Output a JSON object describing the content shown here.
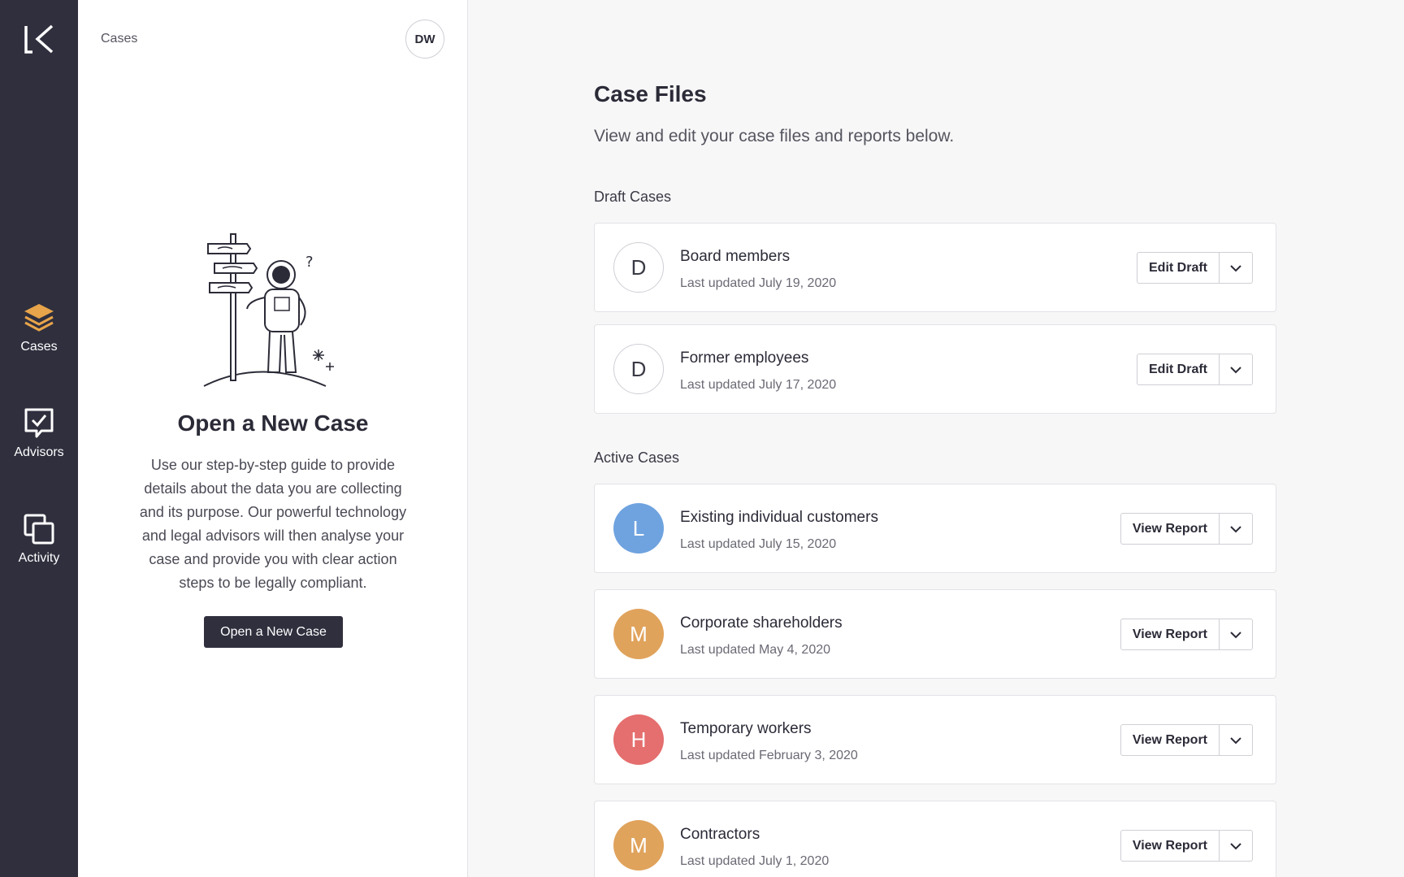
{
  "sidebar": {
    "items": [
      {
        "label": "Cases",
        "icon": "layers-icon",
        "active": true
      },
      {
        "label": "Advisors",
        "icon": "chat-check-icon"
      },
      {
        "label": "Activity",
        "icon": "copy-squares-icon"
      }
    ],
    "accent": "#e8a44a"
  },
  "panel": {
    "breadcrumb": "Cases",
    "user_initials": "DW",
    "title": "Open a New Case",
    "description": "Use our step-by-step guide to provide details about the data you are collecting and its purpose. Our powerful technology and legal advisors will then analyse your case and provide you with clear action steps to be legally compliant.",
    "button_label": "Open a New Case"
  },
  "main": {
    "title": "Case Files",
    "subtitle": "View and edit your case files and reports below.",
    "draft_label": "Draft Cases",
    "active_label": "Active Cases",
    "draft_cases": [
      {
        "initial": "D",
        "name": "Board members",
        "updated": "Last updated July 19, 2020",
        "action": "Edit Draft"
      },
      {
        "initial": "D",
        "name": "Former employees",
        "updated": "Last updated July 17, 2020",
        "action": "Edit Draft"
      }
    ],
    "active_cases": [
      {
        "initial": "L",
        "name": "Existing individual customers",
        "updated": "Last updated July 15, 2020",
        "action": "View Report",
        "color": "#6fa3e0"
      },
      {
        "initial": "M",
        "name": "Corporate shareholders",
        "updated": "Last updated May 4, 2020",
        "action": "View Report",
        "color": "#e0a35c"
      },
      {
        "initial": "H",
        "name": "Temporary workers",
        "updated": "Last updated February 3, 2020",
        "action": "View Report",
        "color": "#e56e6e"
      },
      {
        "initial": "M",
        "name": "Contractors",
        "updated": "Last updated July 1, 2020",
        "action": "View Report",
        "color": "#e0a35c"
      }
    ]
  }
}
